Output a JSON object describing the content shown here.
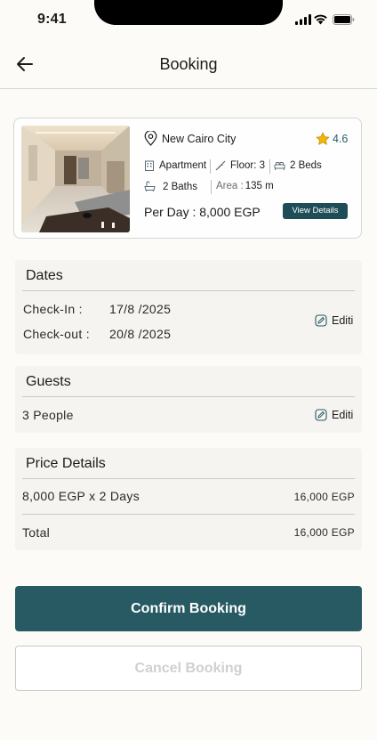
{
  "status_bar": {
    "time": "9:41"
  },
  "header": {
    "title": "Booking"
  },
  "property": {
    "location": "New Cairo City",
    "rating": "4.6",
    "type": "Apartment",
    "floor": "Floor: 3",
    "beds": "2 Beds",
    "baths": "2 Baths",
    "area_label": "Area :",
    "area_value": "135 m",
    "per_day": "Per Day : 8,000 EGP",
    "view_details": "View Details"
  },
  "dates": {
    "title": "Dates",
    "checkin_label": "Check-In :",
    "checkin_value": "17/8 /2025",
    "checkout_label": "Check-out :",
    "checkout_value": "20/8 /2025",
    "edit_label": "Editi"
  },
  "guests": {
    "title": "Guests",
    "value": "3 People",
    "edit_label": "Editi"
  },
  "price": {
    "title": "Price Details",
    "line_label": "8,000 EGP x 2 Days",
    "line_value": "16,000 EGP",
    "total_label": "Total",
    "total_value": "16,000 EGP"
  },
  "actions": {
    "confirm": "Confirm Booking",
    "cancel": "Cancel Booking"
  },
  "colors": {
    "primary": "#275a62",
    "accent": "#275e6b",
    "star": "#f2b705",
    "background": "#fcfbf8"
  }
}
